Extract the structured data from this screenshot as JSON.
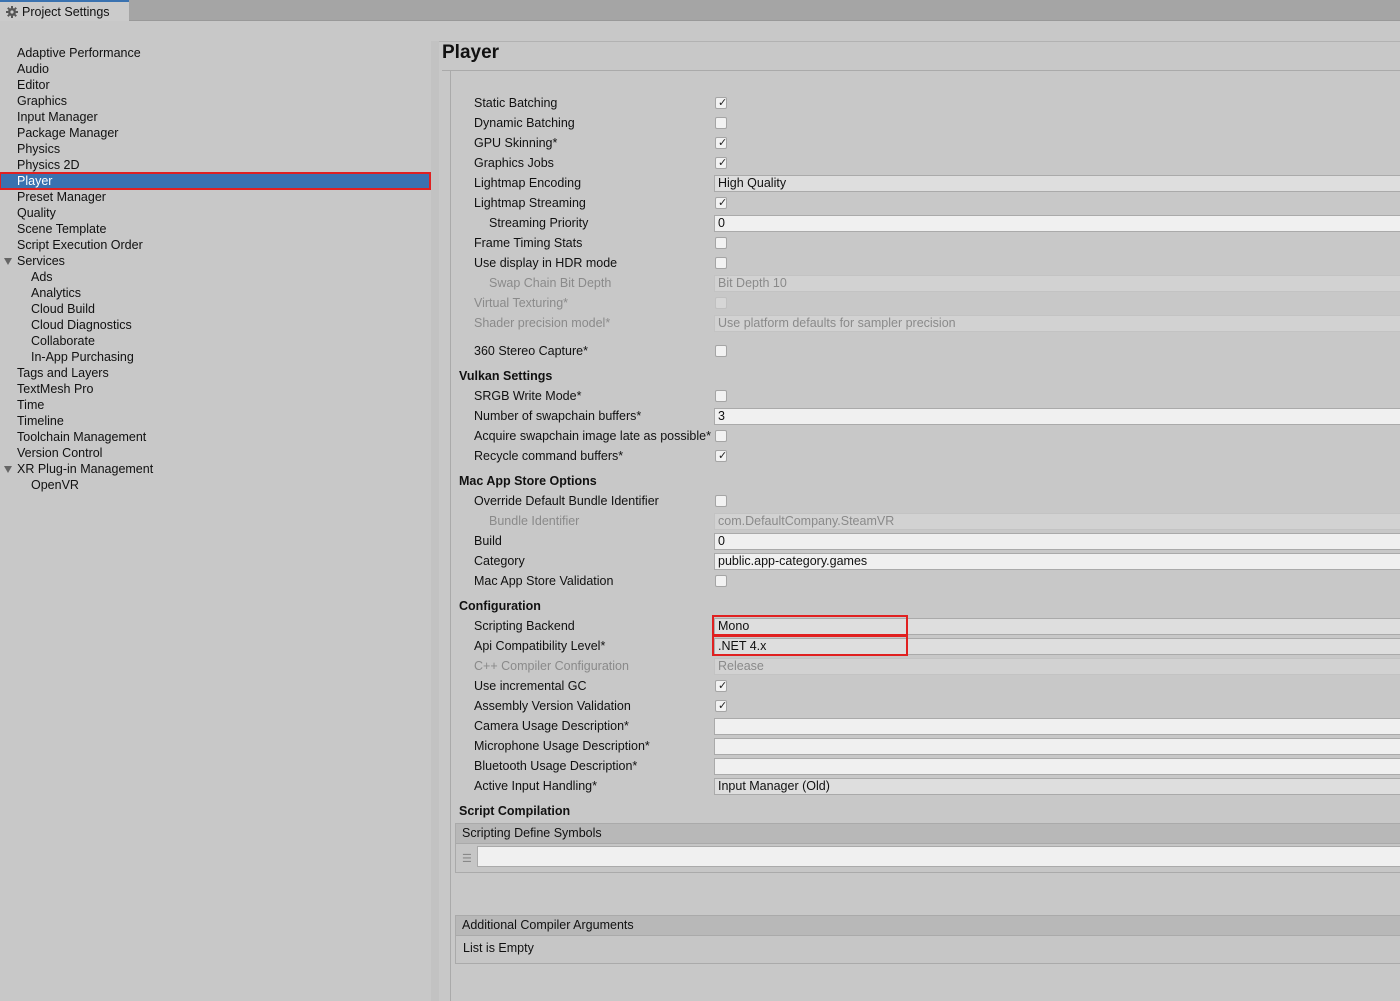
{
  "window": {
    "tab_title": "Project Settings",
    "tab_icon": "gear-icon"
  },
  "sidebar": {
    "items": [
      {
        "label": "Adaptive Performance"
      },
      {
        "label": "Audio"
      },
      {
        "label": "Editor"
      },
      {
        "label": "Graphics"
      },
      {
        "label": "Input Manager"
      },
      {
        "label": "Package Manager"
      },
      {
        "label": "Physics"
      },
      {
        "label": "Physics 2D"
      },
      {
        "label": "Player",
        "selected": true
      },
      {
        "label": "Preset Manager"
      },
      {
        "label": "Quality"
      },
      {
        "label": "Scene Template"
      },
      {
        "label": "Script Execution Order"
      },
      {
        "label": "Services",
        "expanded": true
      },
      {
        "label": "Ads",
        "child": true
      },
      {
        "label": "Analytics",
        "child": true
      },
      {
        "label": "Cloud Build",
        "child": true
      },
      {
        "label": "Cloud Diagnostics",
        "child": true
      },
      {
        "label": "Collaborate",
        "child": true
      },
      {
        "label": "In-App Purchasing",
        "child": true
      },
      {
        "label": "Tags and Layers"
      },
      {
        "label": "TextMesh Pro"
      },
      {
        "label": "Time"
      },
      {
        "label": "Timeline"
      },
      {
        "label": "Toolchain Management"
      },
      {
        "label": "Version Control"
      },
      {
        "label": "XR Plug-in Management",
        "expanded": true
      },
      {
        "label": "OpenVR",
        "child": true
      }
    ]
  },
  "main": {
    "title": "Player",
    "rendering": {
      "static_batching": {
        "label": "Static Batching",
        "checked": true
      },
      "dynamic_batching": {
        "label": "Dynamic Batching",
        "checked": false
      },
      "gpu_skinning": {
        "label": "GPU Skinning*",
        "checked": true
      },
      "graphics_jobs": {
        "label": "Graphics Jobs",
        "checked": true
      },
      "lightmap_encoding": {
        "label": "Lightmap Encoding",
        "value": "High Quality"
      },
      "lightmap_streaming": {
        "label": "Lightmap Streaming",
        "checked": true
      },
      "streaming_priority": {
        "label": "Streaming Priority",
        "value": "0"
      },
      "frame_timing_stats": {
        "label": "Frame Timing Stats",
        "checked": false
      },
      "use_display_hdr": {
        "label": "Use display in HDR mode",
        "checked": false
      },
      "swap_chain_bit_depth": {
        "label": "Swap Chain Bit Depth",
        "value": "Bit Depth 10"
      },
      "virtual_texturing": {
        "label": "Virtual Texturing*",
        "checked": false
      },
      "shader_precision": {
        "label": "Shader precision model*",
        "value": "Use platform defaults for sampler precision"
      },
      "stereo_capture": {
        "label": "360 Stereo Capture*",
        "checked": false
      }
    },
    "vulkan": {
      "heading": "Vulkan Settings",
      "srgb_write": {
        "label": "SRGB Write Mode*",
        "checked": false
      },
      "swapchain_buffers": {
        "label": "Number of swapchain buffers*",
        "value": "3"
      },
      "acquire_late": {
        "label": "Acquire swapchain image late as possible*",
        "checked": false
      },
      "recycle_buffers": {
        "label": "Recycle command buffers*",
        "checked": true
      }
    },
    "mac_app_store": {
      "heading": "Mac App Store Options",
      "override_bundle": {
        "label": "Override Default Bundle Identifier",
        "checked": false
      },
      "bundle_identifier": {
        "label": "Bundle Identifier",
        "value": "com.DefaultCompany.SteamVR"
      },
      "build": {
        "label": "Build",
        "value": "0"
      },
      "category": {
        "label": "Category",
        "value": "public.app-category.games"
      },
      "validation": {
        "label": "Mac App Store Validation",
        "checked": false
      }
    },
    "configuration": {
      "heading": "Configuration",
      "scripting_backend": {
        "label": "Scripting Backend",
        "value": "Mono"
      },
      "api_compat": {
        "label": "Api Compatibility Level*",
        "value": ".NET 4.x"
      },
      "cpp_compiler": {
        "label": "C++ Compiler Configuration",
        "value": "Release"
      },
      "incremental_gc": {
        "label": "Use incremental GC",
        "checked": true
      },
      "assembly_validation": {
        "label": "Assembly Version Validation",
        "checked": true
      },
      "camera_usage": {
        "label": "Camera Usage Description*",
        "value": ""
      },
      "microphone_usage": {
        "label": "Microphone Usage Description*",
        "value": ""
      },
      "bluetooth_usage": {
        "label": "Bluetooth Usage Description*",
        "value": ""
      },
      "active_input": {
        "label": "Active Input Handling*",
        "value": "Input Manager (Old)"
      }
    },
    "script_compilation": {
      "heading": "Script Compilation",
      "define_symbols_header": "Scripting Define Symbols",
      "define_symbols_value": "",
      "handle_icon": "drag-handle-icon",
      "compiler_args_header": "Additional Compiler Arguments",
      "compiler_args_empty": "List is Empty"
    }
  }
}
